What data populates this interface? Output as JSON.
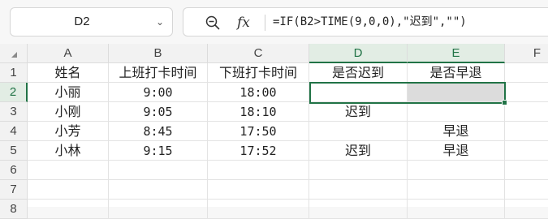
{
  "formula_bar": {
    "cell_reference": "D2",
    "dropdown_arrow": "chevron-down-icon",
    "zoom_icon": "zoom-icon",
    "fx_label": "fx",
    "formula": "=IF(B2>TIME(9,0,0),\"迟到\",\"\")"
  },
  "columns": [
    "A",
    "B",
    "C",
    "D",
    "E",
    "F"
  ],
  "rows": [
    "1",
    "2",
    "3",
    "4",
    "5",
    "6",
    "7",
    "8"
  ],
  "selected_cell": "D2",
  "table": {
    "headers": [
      "姓名",
      "上班打卡时间",
      "下班打卡时间",
      "是否迟到",
      "是否早退"
    ],
    "rows": [
      [
        "小丽",
        "9:00",
        "18:00",
        "",
        ""
      ],
      [
        "小刚",
        "9:05",
        "18:10",
        "迟到",
        ""
      ],
      [
        "小芳",
        "8:45",
        "17:50",
        "",
        "早退"
      ],
      [
        "小林",
        "9:15",
        "17:52",
        "迟到",
        "早退"
      ]
    ]
  },
  "colors": {
    "accent_green": "#217346",
    "selected_fill": "#dcdcdc"
  }
}
